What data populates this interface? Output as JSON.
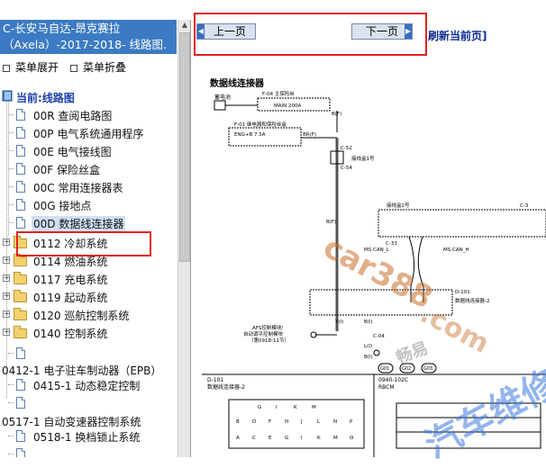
{
  "title": {
    "line1": "C-长安马自达-昂克赛拉",
    "line2": "（Axela）-2017-2018- 线路图."
  },
  "tree_controls": {
    "expand": "菜单展开",
    "collapse": "菜单折叠"
  },
  "tree": {
    "current": "当前:线路图",
    "items": [
      {
        "label": "00R 查阅电路图"
      },
      {
        "label": "00P 电气系统通用程序"
      },
      {
        "label": "00E 电气接线图"
      },
      {
        "label": "00F 保险丝盒"
      },
      {
        "label": "00C 常用连接器表"
      },
      {
        "label": "00G 接地点"
      },
      {
        "label": "00D 数据线连接器"
      },
      {
        "label": "0112 冷却系统"
      },
      {
        "label": "0114 燃油系统"
      },
      {
        "label": "0117 充电系统"
      },
      {
        "label": "0119 起动系统"
      },
      {
        "label": "0120 巡航控制系统"
      },
      {
        "label": "0140 控制系统"
      },
      {
        "label": "0412-1 电子驻车制动器（EPB）"
      },
      {
        "label": "0415-1 动态稳定控制"
      },
      {
        "label": "0517-1 自动变速器控制系统"
      },
      {
        "label": "0518-1 换档锁止系统"
      }
    ]
  },
  "toolbar": {
    "prev": "上一页",
    "next": "下一页",
    "refresh": "刷新当前页]"
  },
  "diagram": {
    "title": "数据线连接器",
    "labels": {
      "f04": "F-04 主保险丝",
      "main": "MAIN 200A",
      "f01": "F-01 继电器和保险丝盒",
      "engb": "ENG+B 7.5A",
      "c52": "C-52",
      "c54": "C-54",
      "jb1": "接线盒1号",
      "jb2": "接线盒2号",
      "c3": "C-3",
      "c33": "C-33",
      "mscanl": "MS CAN_L",
      "mscanh": "MS CAN_H",
      "d101": "D-101",
      "dlc2": "数据线连接器-2",
      "c04": "C-04",
      "afs": "AFS控制模块/",
      "afs2": "自动调平控制模块",
      "afs3": "（第0918-11节）",
      "d101b": "D-101",
      "dlc2b": "数据线连接器-2",
      "rbcm": "0940-102C",
      "rbcm2": "RBCM",
      "battery": "蓄电池",
      "br": "B(F)",
      "brr": "BR(F)",
      "wire_y": "Y(I)",
      "wire_l": "L(I)",
      "wire_b": "B(I)",
      "g01": "G01",
      "g02": "G02",
      "g03": "G03"
    },
    "pins": {
      "row1": [
        "G",
        "I",
        "K",
        "M"
      ],
      "row2": [
        "B",
        "D",
        "F",
        "H",
        "J",
        "L",
        "N",
        "P"
      ],
      "row3": [
        "A",
        "C",
        "E",
        "G",
        "I",
        "K",
        "M",
        "O"
      ]
    }
  },
  "watermark": {
    "a": "car388",
    "b": ".com",
    "c": "汽车维修",
    "d": "畅易"
  }
}
